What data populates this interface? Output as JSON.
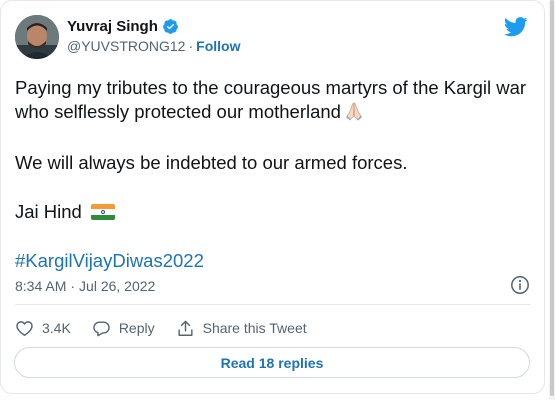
{
  "author": {
    "name": "Yuvraj Singh",
    "handle": "@YUVSTRONG12",
    "separator": "·",
    "follow_label": "Follow"
  },
  "tweet": {
    "paragraph1": "Paying my tributes to the courageous martyrs of the Kargil war who selflessly protected our motherland",
    "paragraph2": "We will always be indebted to our armed forces.",
    "paragraph3": "Jai Hind",
    "hashtag": "#KargilVijayDiwas2022"
  },
  "meta": {
    "time": "8:34 AM",
    "separator": "·",
    "date": "Jul 26, 2022"
  },
  "actions": {
    "like_count": "3.4K",
    "reply_label": "Reply",
    "share_label": "Share this Tweet"
  },
  "read_replies_label": "Read 18 replies",
  "icons": {
    "verified": "verified-badge-icon",
    "brand": "twitter-bird-icon",
    "folded_hands": "folded-hands-emoji",
    "flag": "india-flag-emoji",
    "info": "info-icon",
    "like": "heart-icon",
    "reply": "reply-bubble-icon",
    "share": "share-icon"
  },
  "colors": {
    "link": "#1d73b7",
    "brand": "#1d9bf0",
    "secondary_text": "#536471"
  }
}
